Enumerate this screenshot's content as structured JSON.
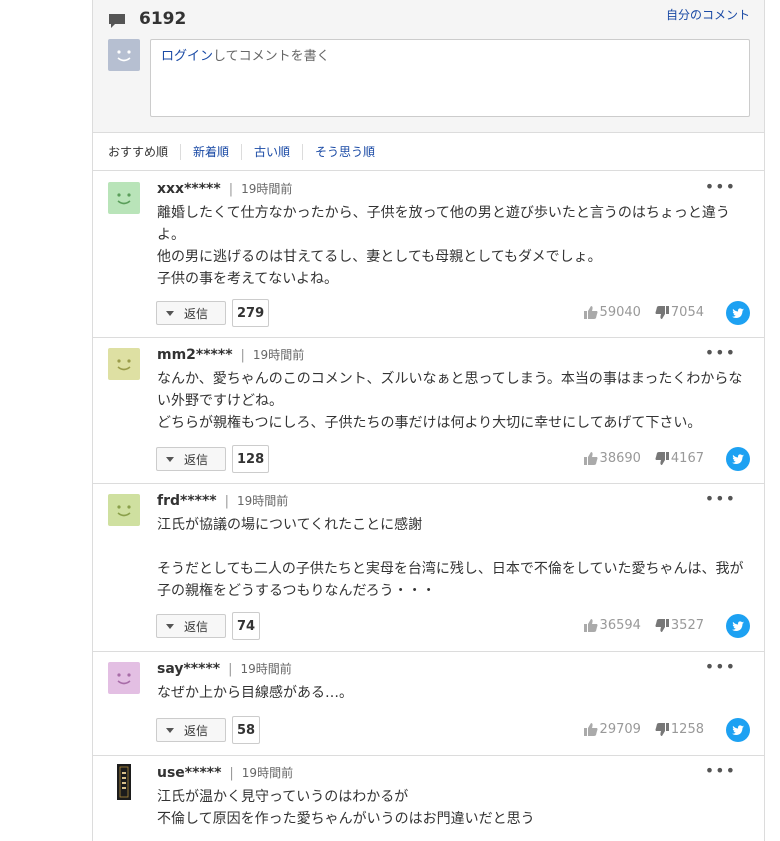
{
  "header": {
    "comment_count": "6192",
    "my_comments_link": "自分のコメント",
    "input_login": "ログイン",
    "input_placeholder_rest": "してコメントを書く"
  },
  "sort": {
    "tabs": [
      "おすすめ順",
      "新着順",
      "古い順",
      "そう思う順"
    ]
  },
  "reply_label": "返信",
  "colors": {
    "link": "#1a4aa5",
    "twitter": "#1da1f2",
    "avatar_green": "#b9e4b9",
    "avatar_yellow": "#dee0a3",
    "avatar_lime": "#cfe0a0",
    "avatar_pink": "#e3bfe3"
  },
  "icons": [
    "comment-bubble-icon",
    "more-options-icon",
    "chevron-down-icon",
    "thumbs-up-icon",
    "thumbs-down-icon",
    "twitter-icon"
  ],
  "comments": [
    {
      "user": "xxx*****",
      "time": "19時間前",
      "lines": [
        "離婚したくて仕方なかったから、子供を放って他の男と遊び歩いたと言うのはちょっと違うよ。",
        "他の男に逃げるのは甘えてるし、妻としても母親としてもダメでしょ。",
        "子供の事を考えてないよね。"
      ],
      "replies": "279",
      "likes": "59040",
      "dislikes": "7054"
    },
    {
      "user": "mm2*****",
      "time": "19時間前",
      "lines": [
        "なんか、愛ちゃんのこのコメント、ズルいなぁと思ってしまう。本当の事はまったくわからない外野ですけどね。",
        "どちらが親権もつにしろ、子供たちの事だけは何より大切に幸せにしてあげて下さい。"
      ],
      "replies": "128",
      "likes": "38690",
      "dislikes": "4167"
    },
    {
      "user": "frd*****",
      "time": "19時間前",
      "lines": [
        "江氏が協議の場についてくれたことに感謝",
        "",
        "そうだとしても二人の子供たちと実母を台湾に残し、日本で不倫をしていた愛ちゃんは、我が子の親権をどうするつもりなんだろう・・・"
      ],
      "replies": "74",
      "likes": "36594",
      "dislikes": "3527"
    },
    {
      "user": "say*****",
      "time": "19時間前",
      "lines": [
        "なぜか上から目線感がある…。"
      ],
      "replies": "58",
      "likes": "29709",
      "dislikes": "1258"
    },
    {
      "user": "use*****",
      "time": "19時間前",
      "lines": [
        "江氏が温かく見守っていうのはわかるが",
        "不倫して原因を作った愛ちゃんがいうのはお門違いだと思う"
      ]
    }
  ]
}
